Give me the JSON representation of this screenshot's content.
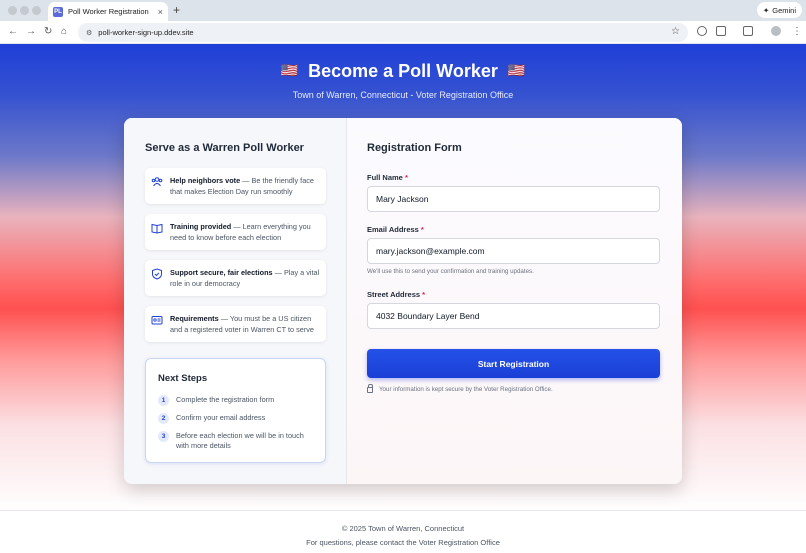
{
  "browser": {
    "tab_title": "Poll Worker Registration",
    "favicon_text": "PL",
    "url": "poll-worker-sign-up.ddev.site",
    "gemini_label": "Gemini"
  },
  "hero": {
    "flag": "🇺🇸",
    "title": "Become a Poll Worker",
    "subtitle": "Town of Warren, Connecticut - Voter Registration Office"
  },
  "info": {
    "title": "Serve as a Warren Poll Worker",
    "benefits": [
      {
        "icon": "people-icon",
        "bold": "Help neighbors vote",
        "text": " — Be the friendly face that makes Election Day run smoothly"
      },
      {
        "icon": "book-icon",
        "bold": "Training provided",
        "text": " — Learn everything you need to know before each election"
      },
      {
        "icon": "shield-icon",
        "bold": "Support secure, fair elections",
        "text": " — Play a vital role in our democracy"
      },
      {
        "icon": "id-card-icon",
        "bold": "Requirements",
        "text": " — You must be a US citizen and a registered voter in Warren CT to serve"
      }
    ],
    "next_steps": {
      "title": "Next Steps",
      "items": [
        {
          "num": "1",
          "text": "Complete the registration form"
        },
        {
          "num": "2",
          "text": "Confirm your email address"
        },
        {
          "num": "3",
          "text": "Before each election we will be in touch with more details"
        }
      ]
    }
  },
  "form": {
    "title": "Registration Form",
    "full_name_label": "Full Name",
    "full_name_value": "Mary Jackson",
    "email_label": "Email Address",
    "email_value": "mary.jackson@example.com",
    "email_hint": "We'll use this to send your confirmation and training updates.",
    "address_label": "Street Address",
    "address_value": "4032 Boundary Layer Bend",
    "required_mark": "*",
    "submit_label": "Start Registration",
    "secure_note": "Your information is kept secure by the Voter Registration Office."
  },
  "footer": {
    "copyright": "© 2025 Town of Warren, Connecticut",
    "contact": "For questions, please contact the Voter Registration Office"
  }
}
